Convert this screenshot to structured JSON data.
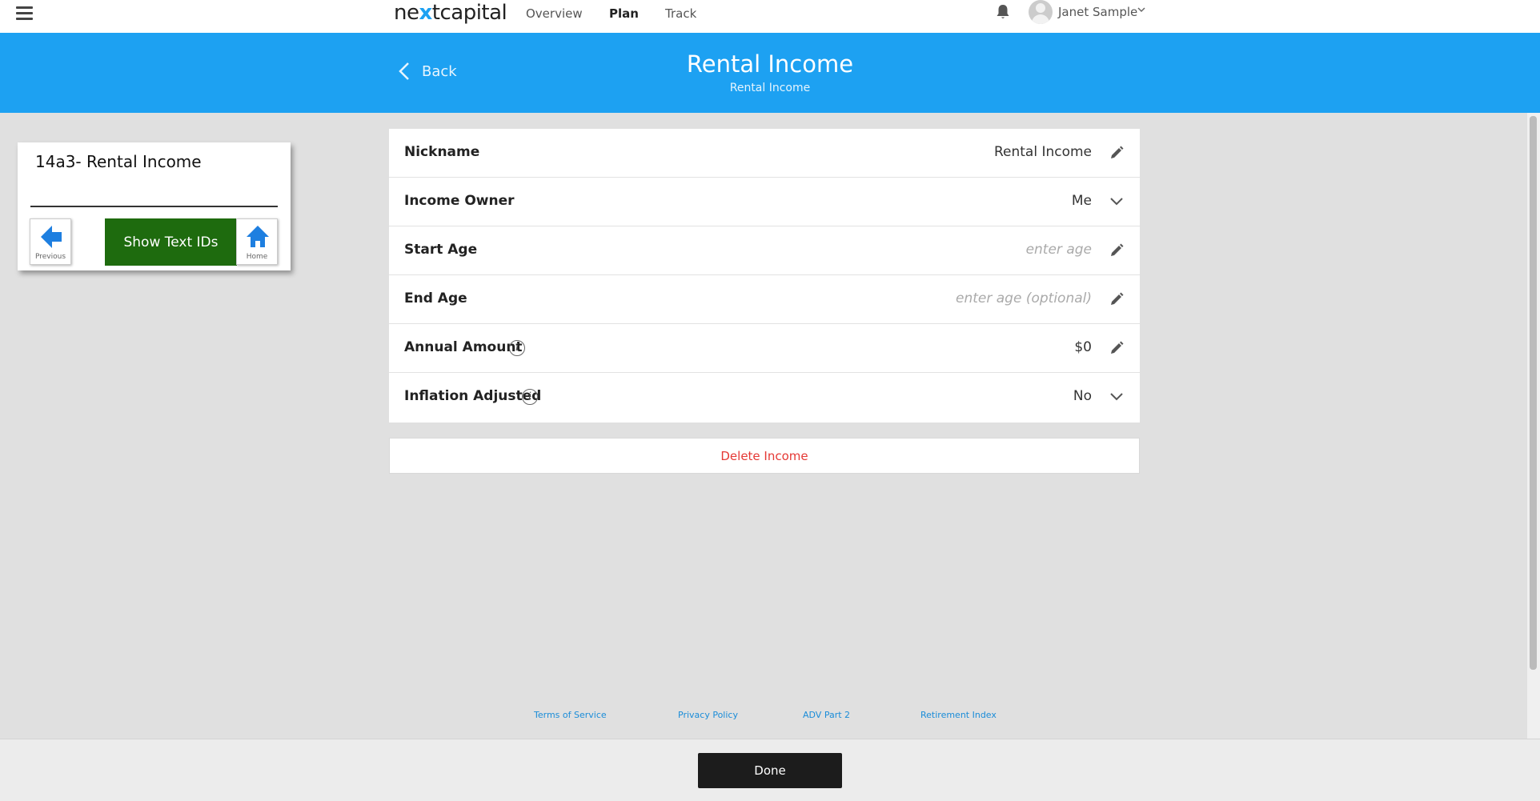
{
  "nav": {
    "logo_prefix": "ne",
    "logo_x": "x",
    "logo_suffix": "tcapital",
    "links": [
      "Overview",
      "Plan",
      "Track"
    ],
    "active": "Plan",
    "user_name": "Janet Sample"
  },
  "header": {
    "back_label": "Back",
    "title": "Rental Income",
    "subtitle": "Rental Income",
    "background": "#1da1f2"
  },
  "test_panel": {
    "title": "14a3- Rental Income",
    "previous_caption": "Previous",
    "show_ids_label": "Show Text IDs",
    "home_caption": "Home",
    "button_color": "#1e6b0e"
  },
  "form": {
    "rows": [
      {
        "label": "Nickname",
        "value": "Rental Income",
        "placeholder": false,
        "info": false,
        "action": "pencil-icon"
      },
      {
        "label": "Income Owner",
        "value": "Me",
        "placeholder": false,
        "info": false,
        "action": "chevron-down-icon"
      },
      {
        "label": "Start Age",
        "value": "enter age",
        "placeholder": true,
        "info": false,
        "action": "pencil-icon"
      },
      {
        "label": "End Age",
        "value": "enter age (optional)",
        "placeholder": true,
        "info": false,
        "action": "pencil-icon"
      },
      {
        "label": "Annual Amount",
        "value": "$0",
        "placeholder": false,
        "info": true,
        "action": "pencil-icon"
      },
      {
        "label": "Inflation Adjusted",
        "value": "No",
        "placeholder": false,
        "info": true,
        "action": "chevron-down-icon"
      }
    ],
    "delete_label": "Delete Income",
    "delete_color": "#e53935"
  },
  "footer": {
    "links": [
      "Terms of Service",
      "Privacy Policy",
      "ADV Part 2",
      "Retirement Index"
    ],
    "done_label": "Done"
  }
}
